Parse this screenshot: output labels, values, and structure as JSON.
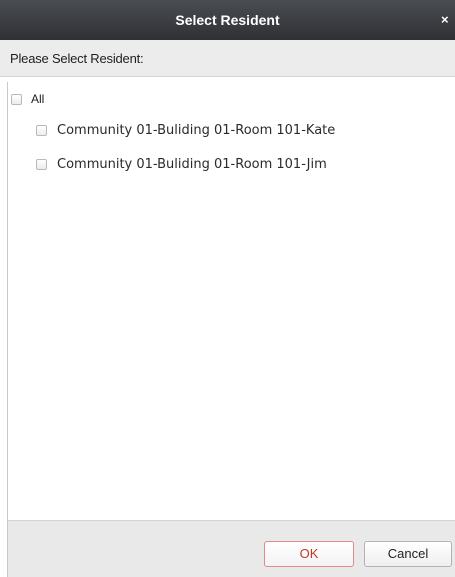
{
  "dialog": {
    "title": "Select Resident",
    "close_glyph": "×",
    "prompt": "Please Select Resident:"
  },
  "list": {
    "all_label": "All",
    "all_checked": false,
    "items": [
      {
        "label": "Community 01-Buliding 01-Room 101-Kate",
        "checked": false
      },
      {
        "label": "Community 01-Buliding 01-Room 101-Jim",
        "checked": false
      }
    ]
  },
  "footer": {
    "ok_label": "OK",
    "cancel_label": "Cancel"
  },
  "colors": {
    "titlebar": "#3a3c40",
    "prompt_bar": "#ececec",
    "footer": "#e9e9e9",
    "ok_text": "#c0392b",
    "ok_border": "#e08a8a"
  }
}
